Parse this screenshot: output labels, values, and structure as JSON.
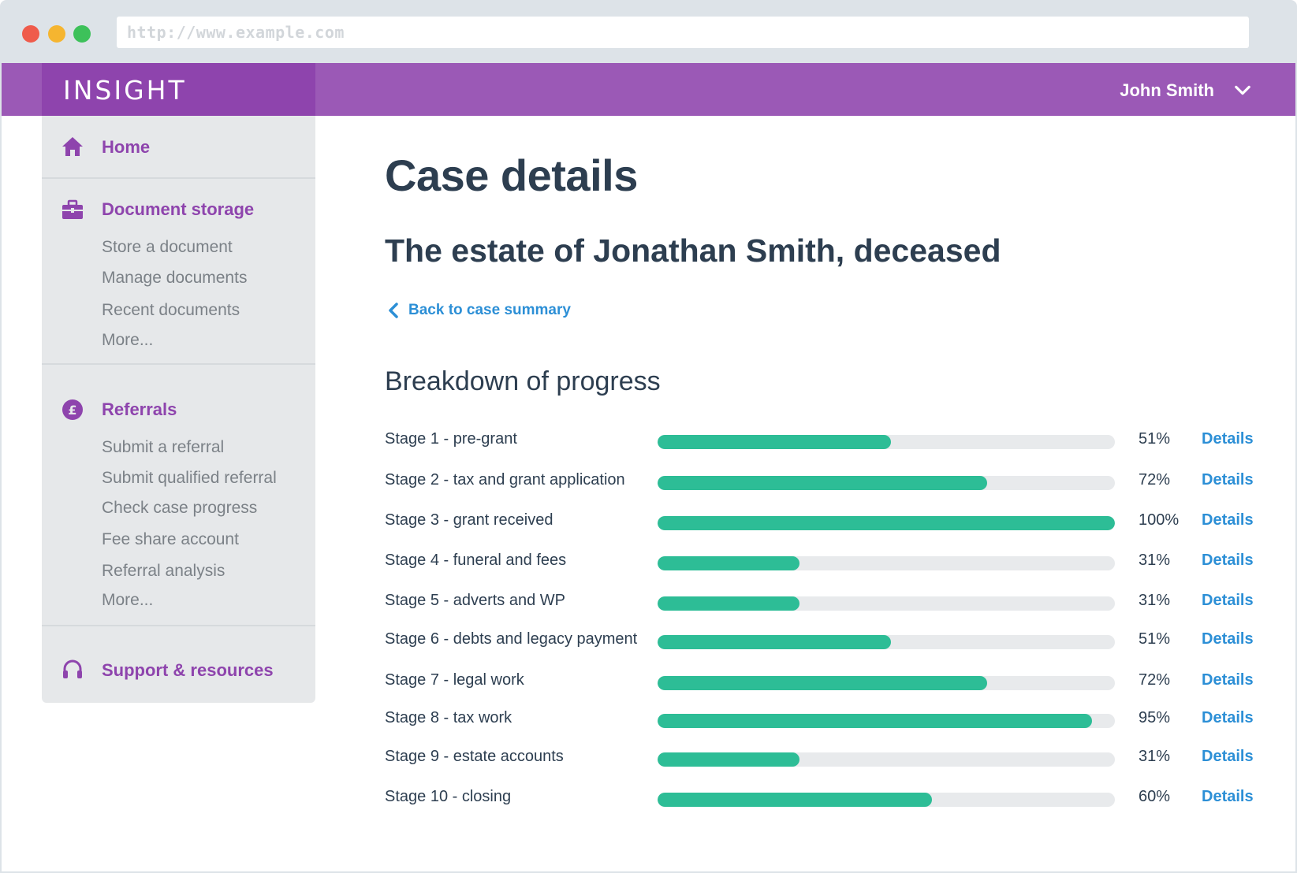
{
  "browser": {
    "url": "http://www.example.com"
  },
  "header": {
    "brand": "INSIGHT",
    "user_name": "John Smith",
    "accent_color": "#9b59b6",
    "brand_color": "#8e44ad"
  },
  "sidebar": {
    "home": {
      "label": "Home",
      "icon": "home-icon"
    },
    "document_storage": {
      "label": "Document storage",
      "icon": "briefcase-icon",
      "items": [
        "Store a document",
        "Manage documents",
        "Recent documents",
        "More..."
      ]
    },
    "referrals": {
      "label": "Referrals",
      "icon": "pound-icon",
      "items": [
        "Submit a referral",
        "Submit qualified referral",
        "Check case progress",
        "Fee share account",
        "Referral analysis",
        "More..."
      ]
    },
    "support": {
      "label": "Support & resources",
      "icon": "headset-icon"
    }
  },
  "main": {
    "title": "Case details",
    "case_name": "The estate of Jonathan Smith, deceased",
    "back_link": "Back to case summary",
    "section_title": "Breakdown of progress",
    "progress_color": "#2dbd96",
    "link_color": "#2c8fd6",
    "stages": [
      {
        "label": "Stage 1 - pre-grant",
        "percent": 51,
        "percent_label": "51%",
        "link": "Details"
      },
      {
        "label": "Stage 2 - tax and grant application",
        "percent": 72,
        "percent_label": "72%",
        "link": "Details"
      },
      {
        "label": "Stage 3 - grant received",
        "percent": 100,
        "percent_label": "100%",
        "link": "Details"
      },
      {
        "label": "Stage 4 - funeral and fees",
        "percent": 31,
        "percent_label": "31%",
        "link": "Details"
      },
      {
        "label": "Stage 5 - adverts and WP",
        "percent": 31,
        "percent_label": "31%",
        "link": "Details"
      },
      {
        "label": "Stage 6 - debts and legacy payment",
        "percent": 51,
        "percent_label": "51%",
        "link": "Details"
      },
      {
        "label": "Stage 7 - legal work",
        "percent": 72,
        "percent_label": "72%",
        "link": "Details"
      },
      {
        "label": "Stage 8 - tax work",
        "percent": 95,
        "percent_label": "95%",
        "link": "Details"
      },
      {
        "label": "Stage 9 - estate accounts",
        "percent": 31,
        "percent_label": "31%",
        "link": "Details"
      },
      {
        "label": "Stage 10 - closing",
        "percent": 60,
        "percent_label": "60%",
        "link": "Details"
      }
    ]
  }
}
